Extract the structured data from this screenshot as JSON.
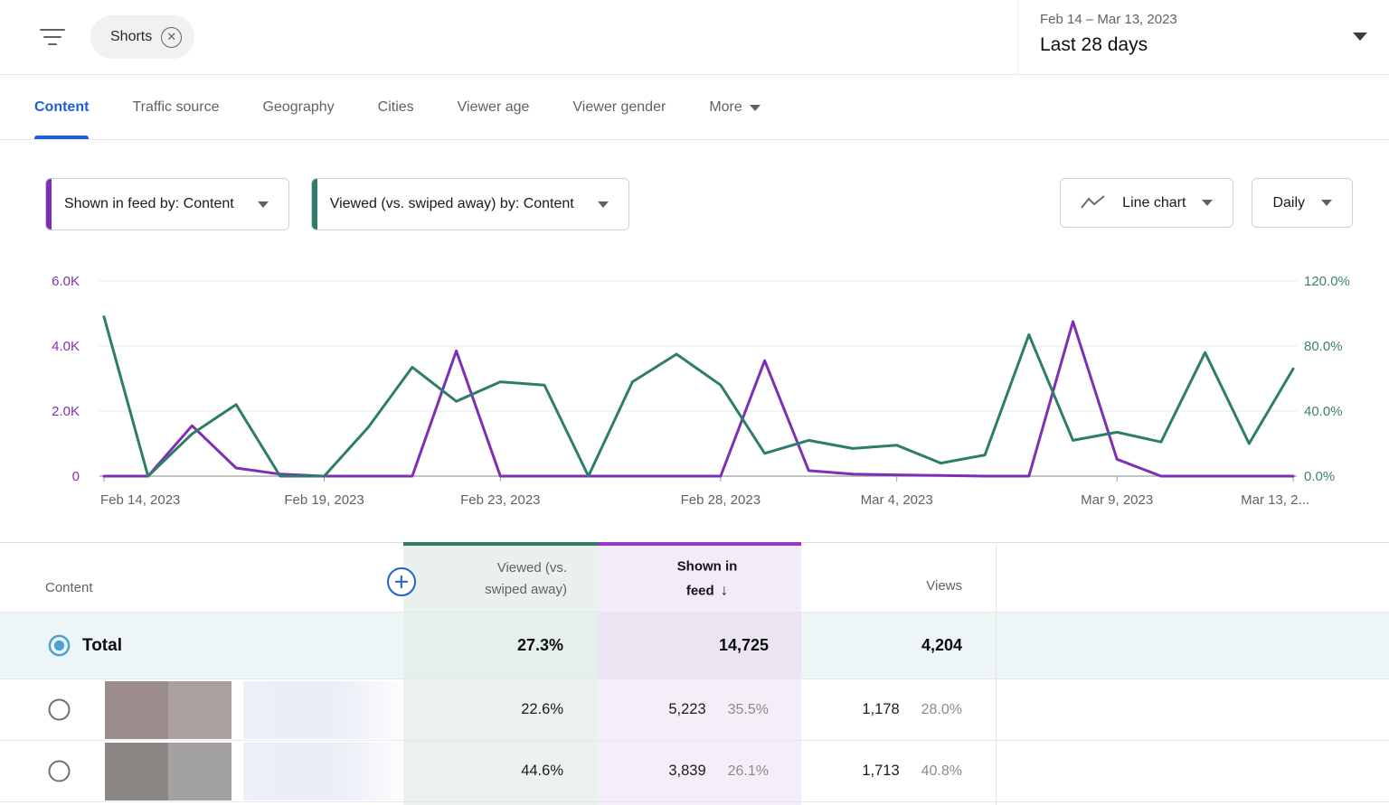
{
  "colors": {
    "active_tab": "#1b5fd1",
    "add_button_blue": "#1d62cf",
    "selected_radio_blue": "#4ba0d6",
    "table_viewed_accent": "#2e7d6b",
    "table_shown_accent": "#9a35c9"
  },
  "header": {
    "filter_chip": "Shorts",
    "date_range": "Feb 14 – Mar 13, 2023",
    "date_preset": "Last 28 days"
  },
  "tabs": [
    {
      "label": "Content",
      "active": true
    },
    {
      "label": "Traffic source"
    },
    {
      "label": "Geography"
    },
    {
      "label": "Cities"
    },
    {
      "label": "Viewer age"
    },
    {
      "label": "Viewer gender"
    },
    {
      "label": "More",
      "has_caret": true
    }
  ],
  "controls": {
    "metric_pickers": [
      {
        "label": "Shown in feed by: Content",
        "accent_color": "#7d2fb5"
      },
      {
        "label": "Viewed (vs. swiped away) by: Content",
        "accent_color": "#2e7d6b"
      }
    ],
    "chart_type": "Line chart",
    "granularity": "Daily"
  },
  "chart_data": {
    "type": "line",
    "x": [
      "Feb 14",
      "Feb 15",
      "Feb 16",
      "Feb 17",
      "Feb 18",
      "Feb 19",
      "Feb 20",
      "Feb 21",
      "Feb 22",
      "Feb 23",
      "Feb 24",
      "Feb 25",
      "Feb 26",
      "Feb 27",
      "Feb 28",
      "Mar 1",
      "Mar 2",
      "Mar 3",
      "Mar 4",
      "Mar 5",
      "Mar 6",
      "Mar 7",
      "Mar 8",
      "Mar 9",
      "Mar 10",
      "Mar 11",
      "Mar 12",
      "Mar 13"
    ],
    "x_ticks": [
      {
        "index": 0,
        "label": "Feb 14, 2023"
      },
      {
        "index": 5,
        "label": "Feb 19, 2023"
      },
      {
        "index": 9,
        "label": "Feb 23, 2023"
      },
      {
        "index": 14,
        "label": "Feb 28, 2023"
      },
      {
        "index": 18,
        "label": "Mar 4, 2023"
      },
      {
        "index": 23,
        "label": "Mar 9, 2023"
      },
      {
        "index": 27,
        "label": "Mar 13, 2..."
      }
    ],
    "left_axis": {
      "labels": [
        "6.0K",
        "4.0K",
        "2.0K",
        "0"
      ],
      "max": 6000,
      "color": "#8434ac"
    },
    "right_axis": {
      "labels": [
        "120.0%",
        "80.0%",
        "40.0%",
        "0.0%"
      ],
      "max": 120,
      "color": "#40806f"
    },
    "grid": true,
    "series": [
      {
        "name": "Shown in feed",
        "axis": "left",
        "color": "#7d2fb5",
        "values": [
          0,
          0,
          1550,
          250,
          60,
          0,
          0,
          0,
          3850,
          0,
          0,
          0,
          0,
          0,
          0,
          3550,
          170,
          60,
          40,
          20,
          0,
          0,
          4750,
          520,
          0,
          0,
          0,
          0
        ]
      },
      {
        "name": "Viewed (vs. swiped away)",
        "axis": "right",
        "color": "#2e7d6b",
        "values": [
          98,
          0,
          26,
          44,
          0,
          0,
          30,
          67,
          46,
          58,
          56,
          0,
          58,
          75,
          56,
          14,
          22,
          17,
          19,
          8,
          13,
          87,
          22,
          27,
          21,
          76,
          20,
          66
        ]
      }
    ]
  },
  "table": {
    "columns": [
      {
        "key": "content",
        "label": "Content"
      },
      {
        "key": "viewed",
        "label": "Viewed (vs. swiped away)"
      },
      {
        "key": "shown",
        "label": "Shown in feed",
        "sort": "desc"
      },
      {
        "key": "views",
        "label": "Views"
      },
      {
        "key": "extra",
        "label": ""
      }
    ],
    "rows": [
      {
        "type": "total",
        "label": "Total",
        "viewed": "27.3%",
        "shown": "14,725",
        "views": "4,204"
      },
      {
        "type": "video",
        "viewed": "22.6%",
        "shown": "5,223",
        "shown_pct": "35.5%",
        "views": "1,178",
        "views_pct": "28.0%",
        "thumb_colors": [
          "#9c8d8c",
          "#a9a09f"
        ]
      },
      {
        "type": "video",
        "viewed": "44.6%",
        "shown": "3,839",
        "shown_pct": "26.1%",
        "views": "1,713",
        "views_pct": "40.8%",
        "thumb_colors": [
          "#8c8685",
          "#a4a1a3"
        ]
      }
    ]
  }
}
